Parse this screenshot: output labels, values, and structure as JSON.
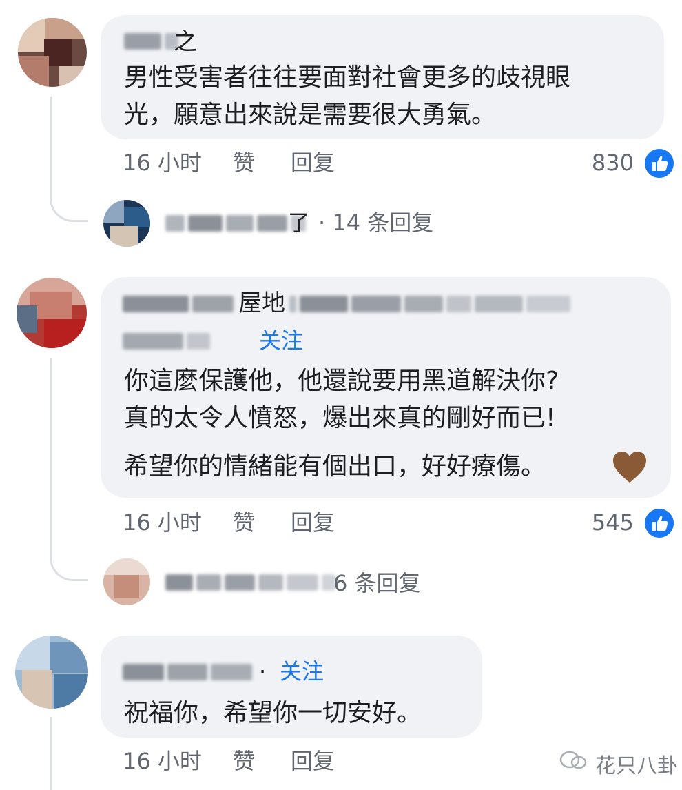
{
  "comments": [
    {
      "name_tail": "之",
      "text_lines": [
        "男性受害者往往要面對社會更多的歧視眼",
        "光，願意出來說是需要很大勇氣。"
      ],
      "time": "16 小时",
      "like_label": "赞",
      "reply_label": "回复",
      "likes": "830",
      "reply_summary": {
        "name_tail": "了",
        "count_text": "· 14 条回复"
      }
    },
    {
      "name_tail": "屋地",
      "follow_label": "关注",
      "text_lines": [
        "你這麼保護他，他還說要用黑道解決你?",
        "真的太令人憤怒，爆出來真的剛好而已!",
        "希望你的情緒能有個出口，好好療傷。"
      ],
      "time": "16 小时",
      "like_label": "赞",
      "reply_label": "回复",
      "likes": "545",
      "reply_summary": {
        "count_text": "6 条回复"
      }
    },
    {
      "follow_label": "关注",
      "text_lines": [
        "祝福你，希望你一切安好。"
      ],
      "time": "16 小时",
      "like_label": "赞",
      "reply_label": "回复"
    }
  ],
  "watermark": "花只八卦",
  "colors": {
    "accent": "#1877f2",
    "bubble": "#f0f2f5",
    "meta": "#606770"
  },
  "icons": [
    "like-thumb-icon",
    "brown-heart-emoji",
    "watermark-logo-icon"
  ]
}
